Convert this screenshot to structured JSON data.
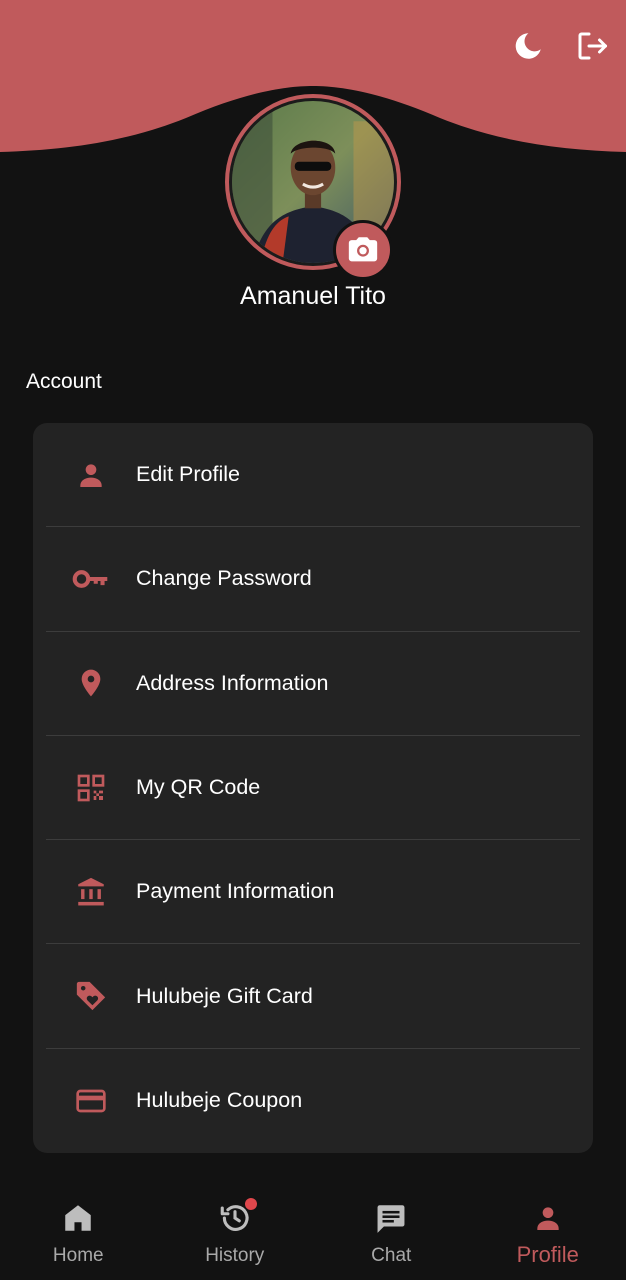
{
  "theme": {
    "accent": "#c05a5c",
    "background": "#121212",
    "card": "#232323",
    "divider": "#3c3c3c",
    "badge": "#e0474c"
  },
  "header": {
    "icons": [
      {
        "name": "dark-mode-moon-icon"
      },
      {
        "name": "logout-icon"
      }
    ]
  },
  "profile": {
    "name": "Amanuel Tito",
    "avatar_icon": "profile-photo",
    "camera_icon": "camera-icon"
  },
  "account": {
    "title": "Account",
    "items": [
      {
        "label": "Edit Profile",
        "icon": "person-icon"
      },
      {
        "label": "Change Password",
        "icon": "key-icon"
      },
      {
        "label": "Address Information",
        "icon": "location-pin-icon"
      },
      {
        "label": "My QR Code",
        "icon": "qr-code-icon"
      },
      {
        "label": "Payment Information",
        "icon": "bank-icon"
      },
      {
        "label": "Hulubeje Gift Card",
        "icon": "gift-tag-icon"
      },
      {
        "label": "Hulubeje Coupon",
        "icon": "credit-card-icon"
      }
    ]
  },
  "nav": {
    "items": [
      {
        "label": "Home",
        "icon": "home-icon",
        "active": false
      },
      {
        "label": "History",
        "icon": "history-icon",
        "active": false,
        "badge": true
      },
      {
        "label": "Chat",
        "icon": "chat-icon",
        "active": false
      },
      {
        "label": "Profile",
        "icon": "person-icon",
        "active": true
      }
    ]
  }
}
